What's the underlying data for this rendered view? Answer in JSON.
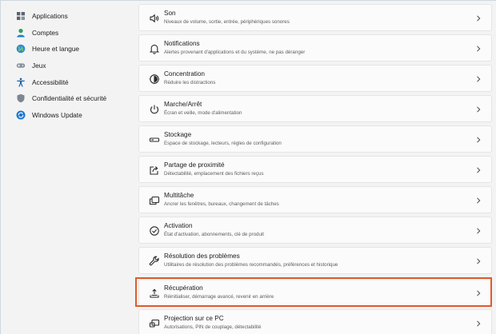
{
  "sidebar": {
    "items": [
      {
        "label": "Applications",
        "icon": "apps-icon"
      },
      {
        "label": "Comptes",
        "icon": "accounts-icon"
      },
      {
        "label": "Heure et langue",
        "icon": "globe-icon"
      },
      {
        "label": "Jeux",
        "icon": "gamepad-icon"
      },
      {
        "label": "Accessibilité",
        "icon": "accessibility-icon"
      },
      {
        "label": "Confidentialité et sécurité",
        "icon": "shield-icon"
      },
      {
        "label": "Windows Update",
        "icon": "update-icon"
      }
    ]
  },
  "settings": {
    "items": [
      {
        "title": "Son",
        "subtitle": "Niveaux de volume, sortie, entrée, périphériques sonores",
        "icon": "speaker-icon"
      },
      {
        "title": "Notifications",
        "subtitle": "Alertes provenant d'applications et du système, ne pas déranger",
        "icon": "bell-icon"
      },
      {
        "title": "Concentration",
        "subtitle": "Réduire les distractions",
        "icon": "focus-icon"
      },
      {
        "title": "Marche/Arrêt",
        "subtitle": "Écran et veille, mode d'alimentation",
        "icon": "power-icon"
      },
      {
        "title": "Stockage",
        "subtitle": "Espace de stockage, lecteurs, règles de configuration",
        "icon": "storage-icon"
      },
      {
        "title": "Partage de proximité",
        "subtitle": "Détectabilité, emplacement des fichiers reçus",
        "icon": "share-icon"
      },
      {
        "title": "Multitâche",
        "subtitle": "Ancrer les fenêtres, bureaux, changement de tâches",
        "icon": "multitask-icon"
      },
      {
        "title": "Activation",
        "subtitle": "État d'activation, abonnements, clé de produit",
        "icon": "check-circle-icon"
      },
      {
        "title": "Résolution des problèmes",
        "subtitle": "Utilitaires de résolution des problèmes recommandés, préférences et historique",
        "icon": "wrench-icon"
      },
      {
        "title": "Récupération",
        "subtitle": "Réinitialiser, démarrage avancé, revenir en arrière",
        "icon": "recovery-icon"
      },
      {
        "title": "Projection sur ce PC",
        "subtitle": "Autorisations, PIN de couplage, détectabilité",
        "icon": "projection-icon"
      }
    ]
  },
  "highlight": {
    "target": "Récupération",
    "color": "#e05a2b"
  }
}
